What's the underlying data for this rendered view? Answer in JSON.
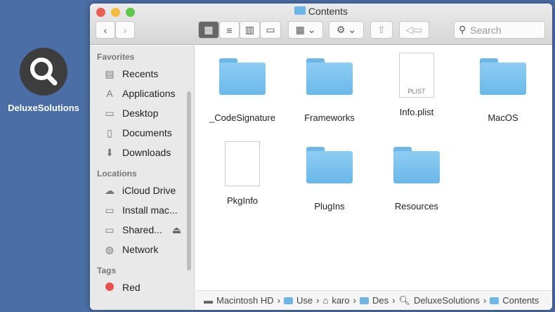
{
  "desktop": {
    "icon_label": "DeluxeSolutions"
  },
  "window": {
    "title": "Contents"
  },
  "toolbar": {
    "search_placeholder": "Search"
  },
  "sidebar": {
    "favorites_header": "Favorites",
    "favorites": [
      {
        "label": "Recents",
        "icon": "clock-icon"
      },
      {
        "label": "Applications",
        "icon": "applications-icon"
      },
      {
        "label": "Desktop",
        "icon": "desktop-icon"
      },
      {
        "label": "Documents",
        "icon": "documents-icon"
      },
      {
        "label": "Downloads",
        "icon": "downloads-icon"
      }
    ],
    "locations_header": "Locations",
    "locations": [
      {
        "label": "iCloud Drive",
        "icon": "cloud-icon"
      },
      {
        "label": "Install mac...",
        "icon": "drive-icon"
      },
      {
        "label": "Shared...",
        "icon": "monitor-icon"
      },
      {
        "label": "Network",
        "icon": "network-icon"
      }
    ],
    "tags_header": "Tags",
    "tags": [
      {
        "label": "Red",
        "color": "#e9514b"
      }
    ]
  },
  "files": [
    {
      "name": "_CodeSignature",
      "type": "folder"
    },
    {
      "name": "Frameworks",
      "type": "folder"
    },
    {
      "name": "Info.plist",
      "type": "plist",
      "badge": "PLIST"
    },
    {
      "name": "MacOS",
      "type": "folder"
    },
    {
      "name": "PkgInfo",
      "type": "document"
    },
    {
      "name": "PlugIns",
      "type": "folder"
    },
    {
      "name": "Resources",
      "type": "folder"
    }
  ],
  "pathbar": [
    "Macintosh HD",
    "Use",
    "karo",
    "Des",
    "DeluxeSolutions",
    "Contents"
  ]
}
